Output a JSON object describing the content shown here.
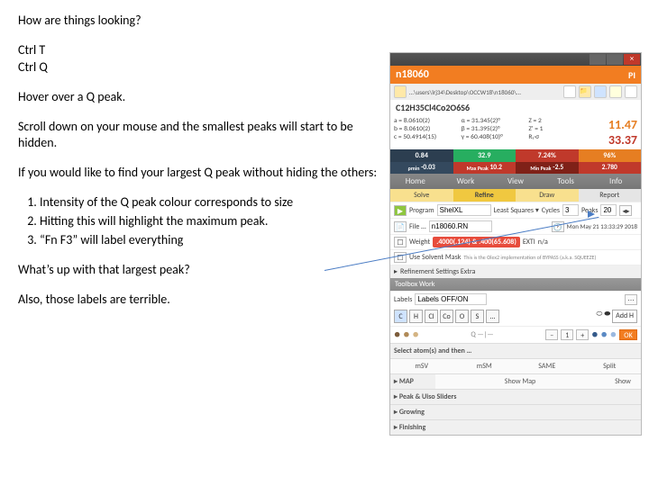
{
  "text": {
    "title": "How are things looking?",
    "l1": "Ctrl T",
    "l2": "Ctrl Q",
    "l3": "Hover over a Q peak.",
    "l4": "Scroll down on your mouse and the smallest peaks will start to be hidden.",
    "l5": "If you would like to find your largest Q peak without hiding the others:",
    "li1": "Intensity of the Q peak colour corresponds to size",
    "li2": "Hitting this will highlight the maximum peak.",
    "li3": "“Fn F3” will label everything",
    "l6": "What’s up with that largest peak?",
    "l7": "Also, those labels are terrible."
  },
  "app": {
    "close_x": "×",
    "id": "n18060",
    "pi": "PI",
    "path": "…\\users\\lrj34\\Desktop\\OCCW18\\n18060\\…",
    "formula": "C12H35Cl4Co2O6S6",
    "openfolder": "📁",
    "stats": {
      "c1a": "a = 8.0610(2)",
      "c1b": "b = 8.0610(2)",
      "c1c": "c = 50.4914(15)",
      "c2a": "α = 31.345(2)°",
      "c2b": "β = 31.395(2)°",
      "c2c": "γ = 60.408(10)°",
      "c3a": "Z = 2",
      "c3b": "Z' = 1",
      "c3c": "R₁·σ",
      "r1": "11.47",
      "r2": "33.37"
    },
    "bar1": {
      "a": "0.84",
      "b": "32.9",
      "c": "7.24%",
      "d": "96%"
    },
    "bar2": {
      "a": "-0.03",
      "b": "10.2",
      "c": "-2.5",
      "d": "2.780",
      "la": "ρmin",
      "lb": "Max Peak",
      "lc": "Min Peak",
      "ld": ""
    },
    "menu": [
      "Home",
      "Work",
      "View",
      "Tools",
      "Info"
    ],
    "sub": {
      "a": "Solve",
      "b": "Refine",
      "c": "Draw",
      "d": "Report"
    },
    "prog_row": {
      "a": "Program",
      "b": "ShelXL",
      "c": "Least Squares ▾",
      "d": "Cycles",
      "e": "3",
      "f": "Peaks",
      "g": "20"
    },
    "file_row": {
      "a": "File …",
      "b": "n18060.RN"
    },
    "date": "Mon May 21  13:33:29 2018",
    "weight_row": {
      "a": "Weight",
      "b": ".4000(.124) & .400(65.608)",
      "c": "EXTI",
      "d": "n/a"
    },
    "mask_row": {
      "a": "Use Solvent Mask",
      "b": "This is the Olex2 implementation of BYPASS (a.k.a. SQUEEZE)"
    },
    "settings": "Refinement Settings Extra",
    "toolbox": "Toolbox Work",
    "labels_row": {
      "a": "Labels",
      "b": "Labels OFF/ON"
    },
    "elems": [
      "C",
      "H",
      "Cl",
      "Co",
      "O",
      "S",
      "…"
    ],
    "ball": "●",
    "addh": "Add H",
    "qslider": "Q —|—",
    "minus": "–",
    "plus": "+",
    "one": "1",
    "ok": "OK",
    "sel_row": "Select atom(s) and then …",
    "sel_cols": [
      "mSV",
      "mSM",
      "SAME",
      "Split"
    ],
    "map_row": {
      "a": "MAP",
      "b": "Show Map",
      "c": "Show"
    },
    "peak_row": "Peak & Uiso Sliders",
    "grow_row": "Growing",
    "fin_row": "Finishing",
    "chev": "▸"
  }
}
